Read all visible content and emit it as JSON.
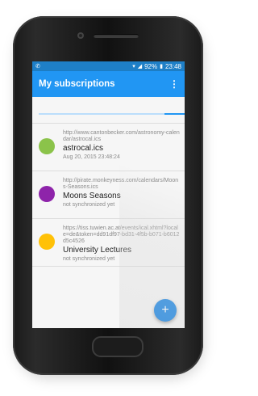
{
  "status_bar": {
    "left_icon": "sim-icon",
    "battery": "92%",
    "time": "23:48"
  },
  "app_bar": {
    "title": "My subscriptions",
    "menu_icon": "overflow-menu-icon"
  },
  "colors": {
    "app_bar": "#2196f3",
    "status_bar": "#1e7fc7",
    "fab": "#1e88e5"
  },
  "sync_progress": 0.14,
  "subscriptions": [
    {
      "url": "http://www.cantonbecker.com/astronomy-calendar/astrocal.ics",
      "name": "astrocal.ics",
      "status": "Aug 20, 2015 23:48:24",
      "color": "#8bc34a"
    },
    {
      "url": "http://pirate.monkeyness.com/calendars/Moons-Seasons.ics",
      "name": "Moons Seasons",
      "status": "not synchronized yet",
      "color": "#8e24aa"
    },
    {
      "url": "https://tiss.tuwien.ac.at/events/ical.xhtml?locale=de&token=dd91df97-bd31-4f5b-b071-b6012d5c4526",
      "name": "University Lectures",
      "status": "not synchronized yet",
      "color": "#ffc107"
    }
  ],
  "fab": {
    "label": "+",
    "icon": "add-icon"
  }
}
